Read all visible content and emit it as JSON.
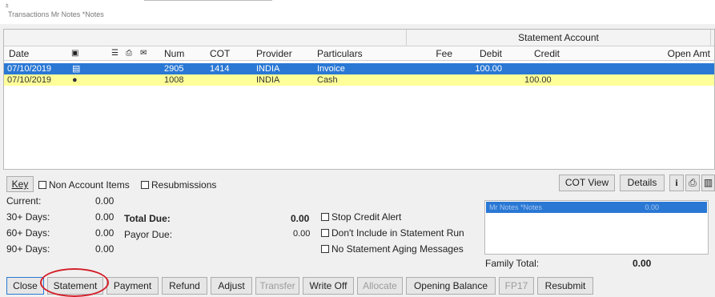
{
  "window": {
    "title": "Transactions Mr Notes *Notes"
  },
  "grid": {
    "group_header": "Statement Account",
    "columns": [
      "Date",
      "Num",
      "COT",
      "Provider",
      "Particulars",
      "Fee",
      "Debit",
      "Credit",
      "Open Amt"
    ],
    "rows": [
      {
        "date": "07/10/2019",
        "num": "2905",
        "cot": "1414",
        "provider": "INDIA",
        "particulars": "Invoice",
        "fee": "",
        "debit": "100.00",
        "credit": "",
        "open_amt": ""
      },
      {
        "date": "07/10/2019",
        "num": "1008",
        "cot": "",
        "provider": "INDIA",
        "particulars": "Cash",
        "fee": "",
        "debit": "",
        "credit": "100.00",
        "open_amt": ""
      }
    ]
  },
  "options": {
    "key_label": "Key",
    "non_account_items": "Non Account Items",
    "resubmissions": "Resubmissions",
    "cot_view": "COT View",
    "details": "Details"
  },
  "aging": {
    "current_label": "Current:",
    "current_value": "0.00",
    "d30_label": "30+ Days:",
    "d30_value": "0.00",
    "d60_label": "60+ Days:",
    "d60_value": "0.00",
    "d90_label": "90+ Days:",
    "d90_value": "0.00"
  },
  "totals": {
    "total_due_label": "Total Due:",
    "total_due_value": "0.00",
    "payor_due_label": "Payor Due:",
    "payor_due_value": "0.00"
  },
  "checks": {
    "stop_credit_alert": "Stop Credit Alert",
    "dont_include": "Don't Include in Statement Run",
    "no_aging": "No Statement Aging Messages"
  },
  "family": {
    "item_name": "Mr Notes *Notes",
    "item_amount": "0.00",
    "total_label": "Family Total:",
    "total_value": "0.00"
  },
  "footer": {
    "close": "Close",
    "statement": "Statement",
    "payment": "Payment",
    "refund": "Refund",
    "adjust": "Adjust",
    "transfer": "Transfer",
    "write_off": "Write Off",
    "allocate": "Allocate",
    "opening_balance": "Opening Balance",
    "fp17": "FP17",
    "resubmit": "Resubmit"
  },
  "colors": {
    "selection": "#2a78d4",
    "highlight": "#ffff99",
    "annotation": "#d3202a"
  }
}
